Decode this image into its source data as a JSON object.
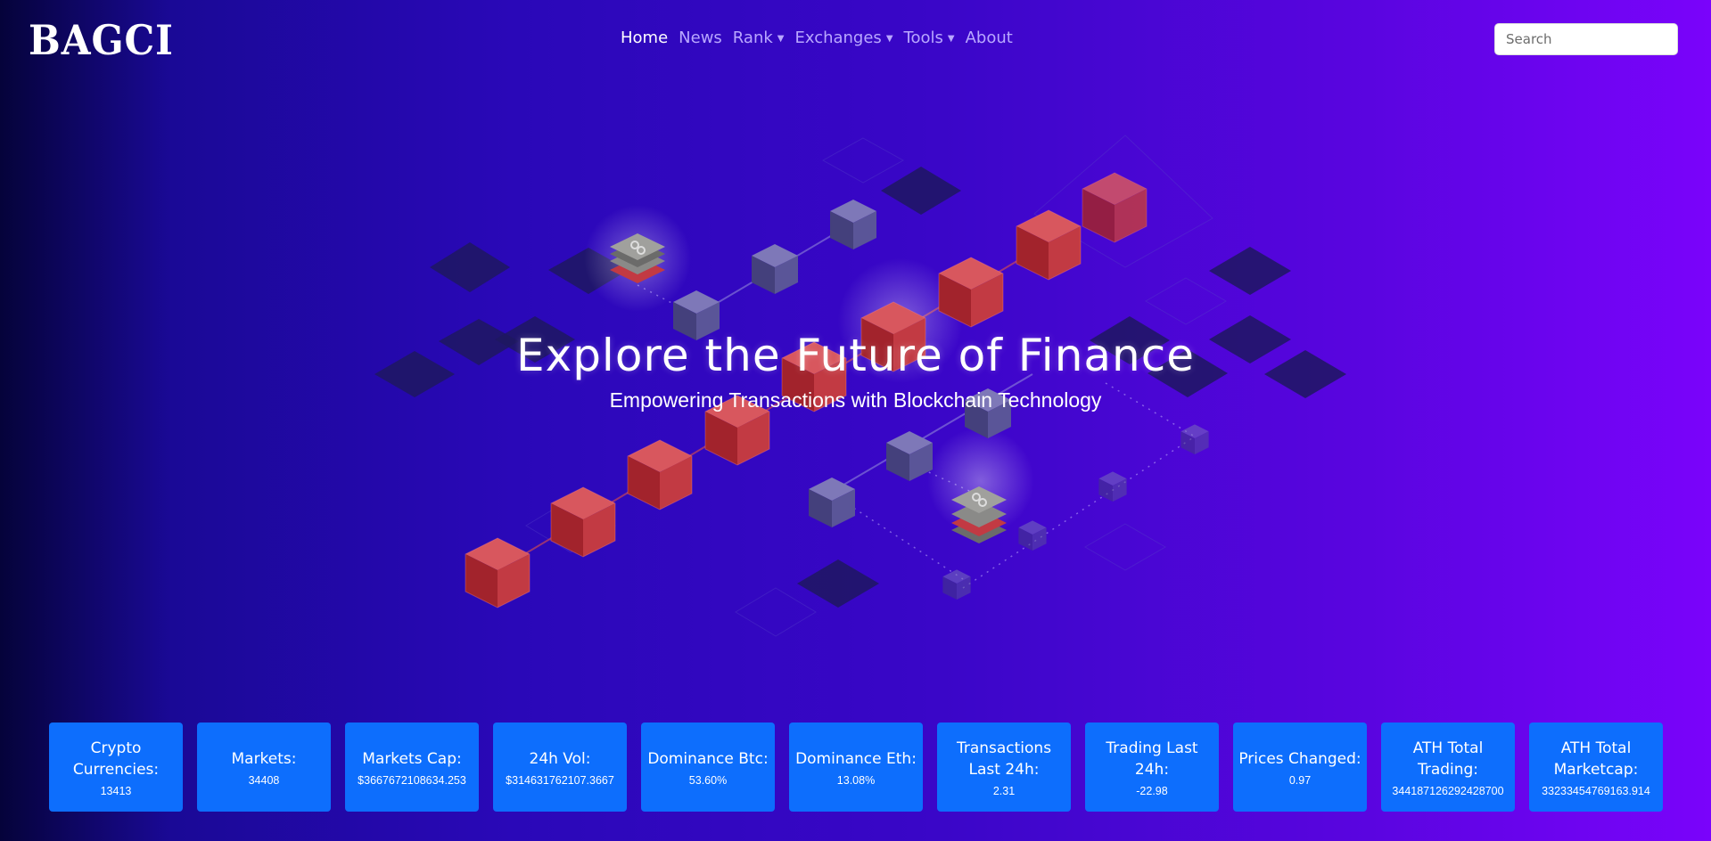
{
  "brand": {
    "logo": "BAGCI"
  },
  "nav": {
    "home": "Home",
    "news": "News",
    "rank": "Rank",
    "exchanges": "Exchanges",
    "tools": "Tools",
    "about": "About"
  },
  "search": {
    "placeholder": "Search"
  },
  "hero": {
    "title": "Explore the Future of Finance",
    "subtitle": "Empowering Transactions with Blockchain Technology"
  },
  "stats": [
    {
      "label": "Crypto Currencies:",
      "value": "13413"
    },
    {
      "label": "Markets:",
      "value": "34408"
    },
    {
      "label": "Markets Cap:",
      "value": "$3667672108634.253"
    },
    {
      "label": "24h Vol:",
      "value": "$314631762107.3667"
    },
    {
      "label": "Dominance Btc:",
      "value": "53.60%"
    },
    {
      "label": "Dominance Eth:",
      "value": "13.08%"
    },
    {
      "label": "Transactions Last 24h:",
      "value": "2.31"
    },
    {
      "label": "Trading Last 24h:",
      "value": "-22.98"
    },
    {
      "label": "Prices Changed:",
      "value": "0.97"
    },
    {
      "label": "ATH Total Trading:",
      "value": "344187126292428700"
    },
    {
      "label": "ATH Total Marketcap:",
      "value": "33233454769163.914"
    }
  ],
  "colors": {
    "card": "#0d6efd",
    "cube_red": "#b3262e",
    "cube_purple": "#4a4590",
    "diamond_dark": "#1c1660"
  }
}
